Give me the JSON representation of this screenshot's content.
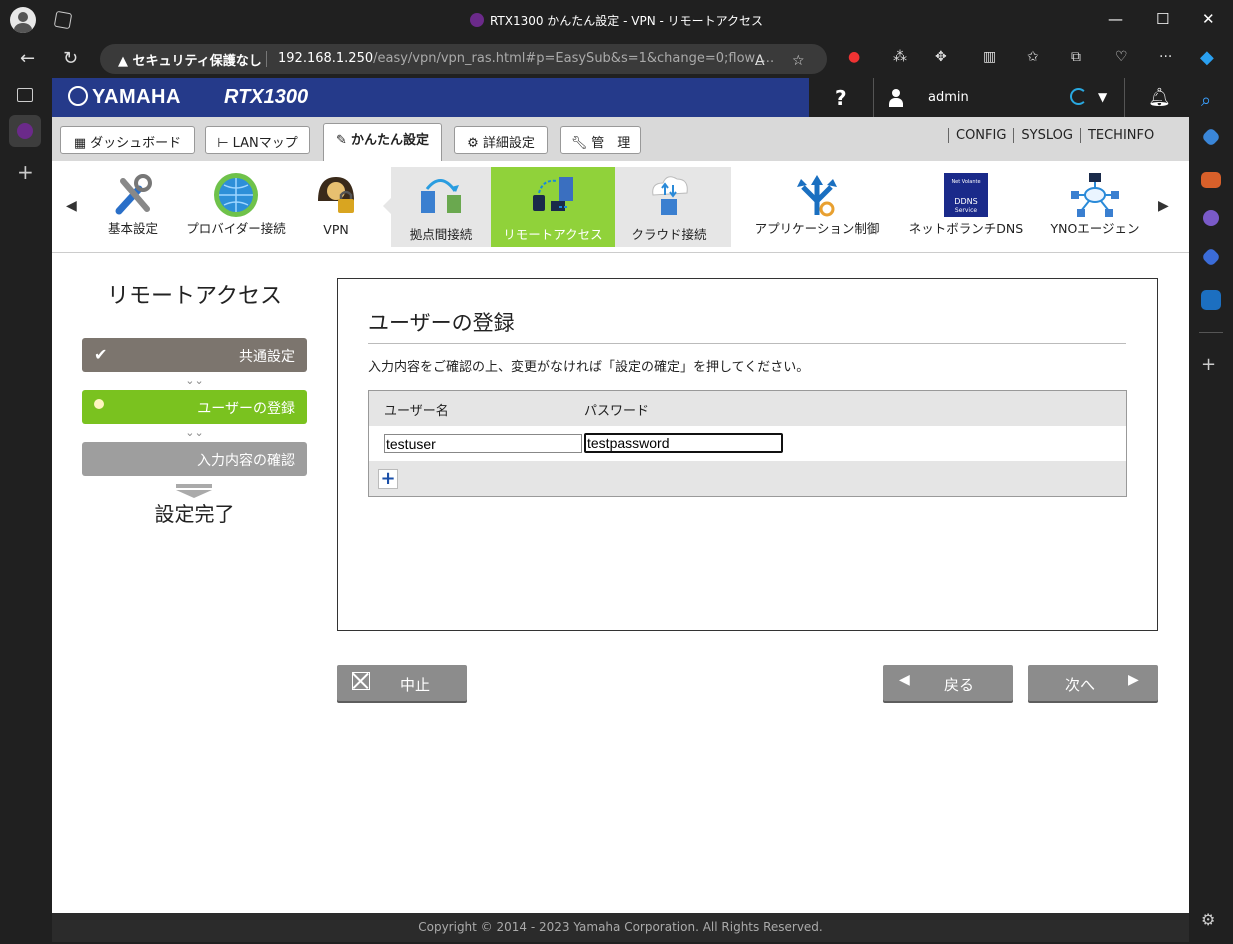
{
  "window": {
    "title": "RTX1300 かんたん設定 - VPN - リモートアクセス",
    "minimize": "—",
    "maximize": "☐",
    "close": "✕"
  },
  "addressbar": {
    "security_label": "▲ セキュリティ保護なし",
    "url_host": "192.168.1.250",
    "url_path": "/easy/vpn/vpn_ras.html#p=EasySub&s=1&change=0;flow_..."
  },
  "header": {
    "brand": "YAMAHA",
    "model": "RTX1300",
    "help": "?",
    "username": "admin"
  },
  "tabs": [
    {
      "label": "ダッシュボード",
      "icon": "dashboard-icon"
    },
    {
      "label": "LANマップ",
      "icon": "lan-map-icon"
    },
    {
      "label": "かんたん設定",
      "icon": "wand-icon"
    },
    {
      "label": "詳細設定",
      "icon": "gear-icon"
    },
    {
      "label": "管　理",
      "icon": "wrench-icon"
    }
  ],
  "toplinks": [
    "CONFIG",
    "SYSLOG",
    "TECHINFO"
  ],
  "iconbar": {
    "items": [
      {
        "label": "基本設定",
        "icon": "tools-icon"
      },
      {
        "label": "プロバイダー接続",
        "icon": "globe-icon"
      },
      {
        "label": "VPN",
        "icon": "vpn-lock-icon"
      },
      {
        "label": "拠点間接続",
        "icon": "site-to-site-icon"
      },
      {
        "label": "リモートアクセス",
        "icon": "remote-access-icon"
      },
      {
        "label": "クラウド接続",
        "icon": "cloud-icon"
      },
      {
        "label": "アプリケーション制御",
        "icon": "app-control-icon"
      },
      {
        "label": "ネットボランチDNS",
        "icon": "ddns-icon"
      },
      {
        "label": "YNOエージェン",
        "icon": "network-icon"
      }
    ],
    "ddns_badge": "DDNS\nService"
  },
  "wizard": {
    "title": "リモートアクセス",
    "steps": [
      {
        "label": "共通設定",
        "state": "done"
      },
      {
        "label": "ユーザーの登録",
        "state": "current"
      },
      {
        "label": "入力内容の確認",
        "state": "todo"
      }
    ],
    "final": "設定完了"
  },
  "panel": {
    "title": "ユーザーの登録",
    "description": "入力内容をご確認の上、変更がなければ「設定の確定」を押してください。",
    "col_user": "ユーザー名",
    "col_password": "パスワード",
    "username_value": "testuser",
    "password_value": "testpassword",
    "add_label": "+"
  },
  "buttons": {
    "cancel": "中止",
    "back": "戻る",
    "next": "次へ"
  },
  "footer": "Copyright © 2014 - 2023 Yamaha Corporation. All Rights Reserved.",
  "colors": {
    "header_blue": "#253a8a",
    "current_step": "#7ac21f",
    "selected_icon": "#90d23a"
  }
}
